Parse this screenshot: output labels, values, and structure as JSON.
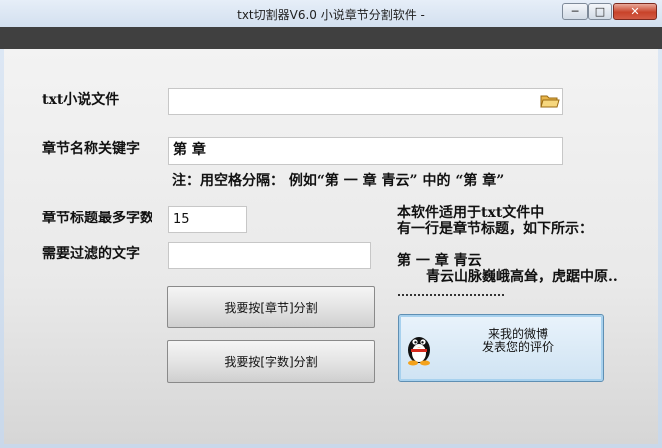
{
  "window": {
    "title": "txt切割器V6.0 小说章节分割软件 -",
    "minimize_glyph": "─",
    "maximize_glyph": "□",
    "close_glyph": "✕"
  },
  "form": {
    "file_label": "txt小说文件",
    "file_value": "",
    "keyword_label": "章节名称关键字",
    "keyword_value": "第 章",
    "hint": "注：用空格分隔：   例如“第 一 章  青云” 中的 “第 章”",
    "maxlen_label": "章节标题最多字数",
    "maxlen_value": "15",
    "filter_label": "需要过滤的文字",
    "filter_value": ""
  },
  "buttons": {
    "split_by_chapter": "我要按[章节]分割",
    "split_by_count": "我要按[字数]分割",
    "weibo_line1": "来我的微博",
    "weibo_line2": "发表您的评价"
  },
  "info": {
    "line1": "本软件适用于txt文件中",
    "line2": "有一行是章节标题，如下所示：",
    "example_title": "第 一 章  青云",
    "example_body": "青云山脉巍峨高耸，虎踞中原.."
  },
  "icons": {
    "folder": "folder-open-icon",
    "qq": "qq-penguin-icon"
  }
}
